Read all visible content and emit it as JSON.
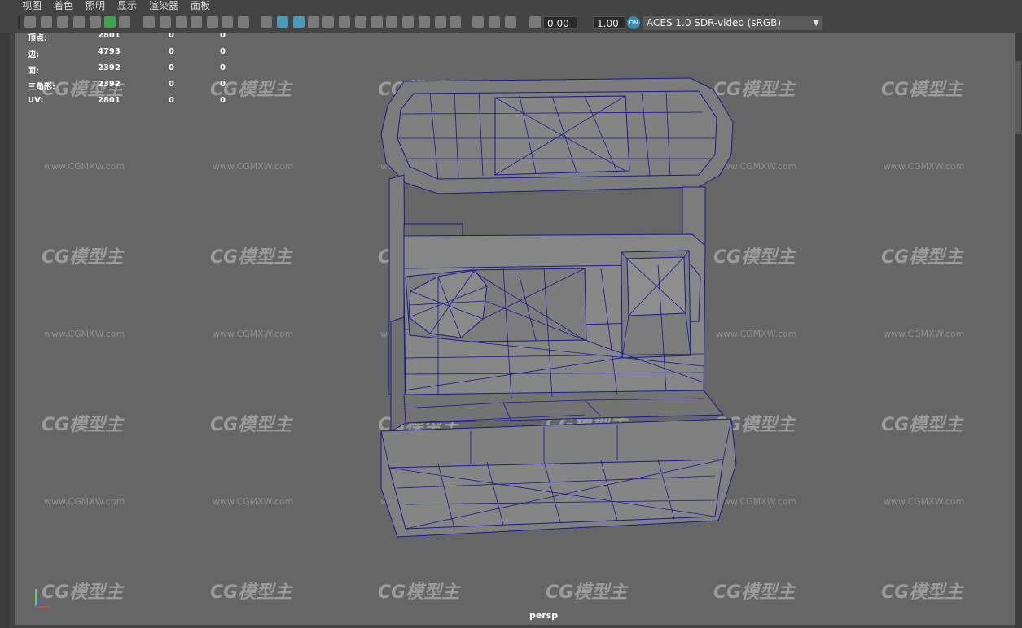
{
  "menu": [
    "视图",
    "着色",
    "照明",
    "显示",
    "渲染器",
    "面板"
  ],
  "toolbar": {
    "exposure_value": "0.00",
    "gamma_value": "1.00",
    "ocio_badge": "ON",
    "colorspace": "ACES 1.0 SDR-video (sRGB)",
    "icons": [
      "camera-select-icon",
      "camera-attributes-icon",
      "bookmark-icon",
      "image-plane-icon",
      "2d-pan-zoom-icon",
      "grease-pencil-icon",
      "grid-icon",
      "film-gate-icon",
      "resolution-gate-icon",
      "gate-mask-icon",
      "field-chart-icon",
      "safe-action-icon",
      "safe-title-icon",
      "wireframe-icon",
      "smooth-shade-icon",
      "default-material-icon",
      "wireframe-on-shaded-icon",
      "xray-icon",
      "use-all-lights-icon",
      "shadows-icon",
      "screen-space-ao-icon",
      "motion-blur-icon",
      "multisample-aa-icon",
      "depth-of-field-icon",
      "isolate-select-icon",
      "xray-joints-icon",
      "xray-active-icon",
      "backface-culling-icon",
      "exposure-icon",
      "gamma-icon",
      "view-transform-icon"
    ]
  },
  "hud": {
    "rows": [
      {
        "label": "顶点:",
        "v1": "2801",
        "v2": "0",
        "v3": "0"
      },
      {
        "label": "边:",
        "v1": "4793",
        "v2": "0",
        "v3": "0"
      },
      {
        "label": "面:",
        "v1": "2392",
        "v2": "0",
        "v3": "0"
      },
      {
        "label": "三角形:",
        "v1": "2392",
        "v2": "0",
        "v3": "0"
      },
      {
        "label": "UV:",
        "v1": "2801",
        "v2": "0",
        "v3": "0"
      }
    ]
  },
  "viewport": {
    "camera": "persp",
    "background_color": "#666666",
    "wire_color": "#1a1a8c",
    "watermark_logo": "CG模型主",
    "watermark_url": "www.CGMXW.com"
  }
}
